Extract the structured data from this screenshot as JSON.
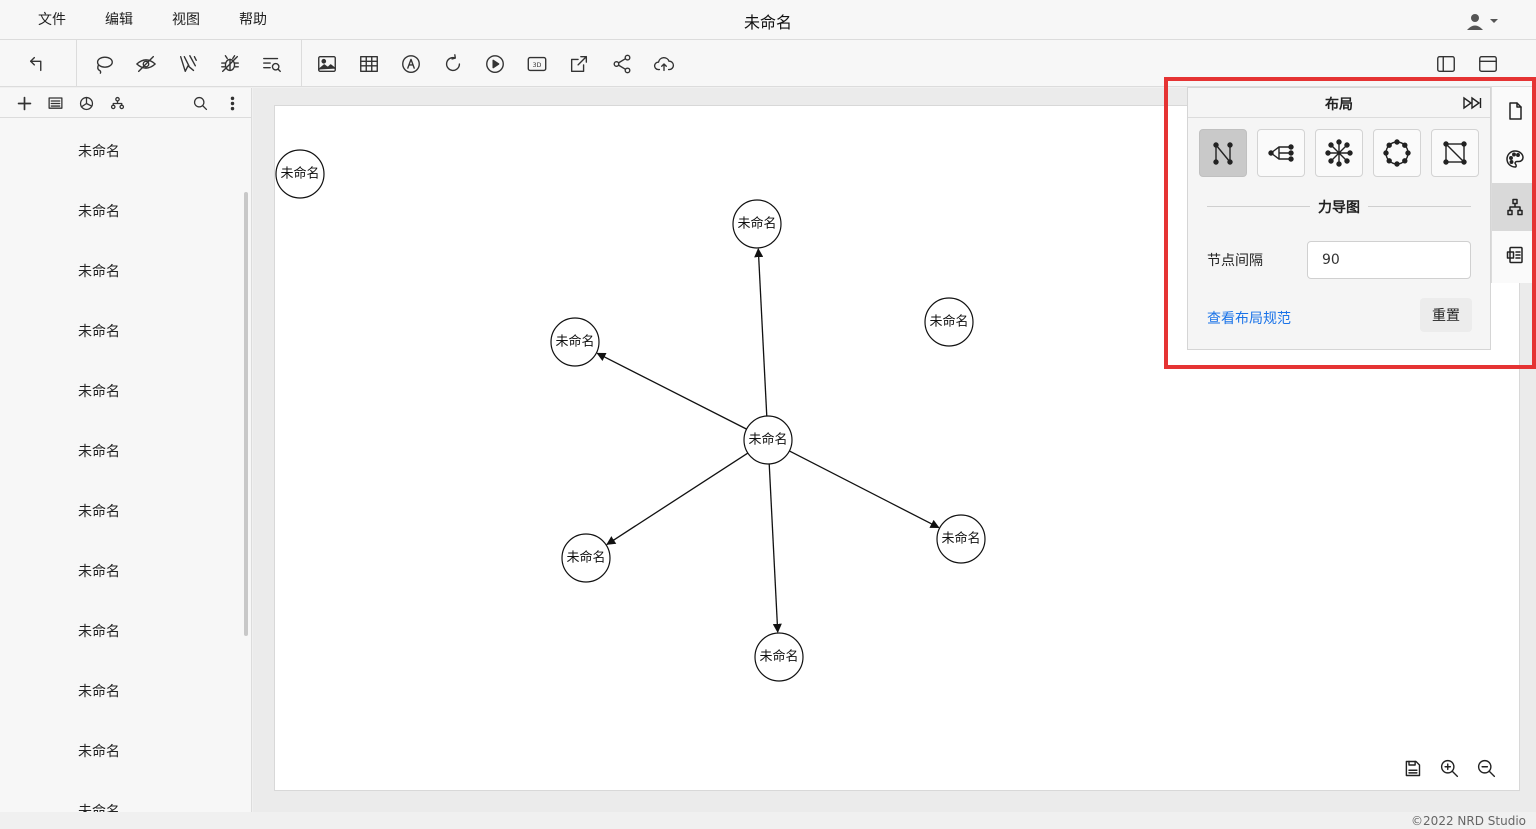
{
  "menu": {
    "items": [
      "文件",
      "编辑",
      "视图",
      "帮助"
    ],
    "title": "未命名"
  },
  "toolbar": {
    "buttons": [
      "undo-icon",
      "lasso-icon",
      "eye-off-icon",
      "brush-icon",
      "bug-icon",
      "filter-search-icon",
      "image-icon",
      "table-icon",
      "text-icon",
      "refresh-icon",
      "play-icon",
      "3d-icon",
      "export-icon",
      "share-icon",
      "cloud-upload-icon",
      "toggle-sidebar-icon",
      "toggle-panel-icon"
    ]
  },
  "sidebar": {
    "items": [
      "未命名",
      "未命名",
      "未命名",
      "未命名",
      "未命名",
      "未命名",
      "未命名",
      "未命名",
      "未命名",
      "未命名",
      "未命名",
      "未命名"
    ]
  },
  "graph": {
    "nodes": [
      {
        "label": "未命名"
      },
      {
        "label": "未命名"
      },
      {
        "label": "未命名"
      },
      {
        "label": "未命名"
      },
      {
        "label": "未命名"
      },
      {
        "label": "未命名"
      },
      {
        "label": "未命名"
      },
      {
        "label": "未命名"
      }
    ],
    "edges": [
      {
        "from": 4,
        "to": 1
      },
      {
        "from": 4,
        "to": 2
      },
      {
        "from": 4,
        "to": 5
      },
      {
        "from": 4,
        "to": 6
      },
      {
        "from": 4,
        "to": 7
      }
    ]
  },
  "layout_panel": {
    "title": "布局",
    "options": [
      "force-layout-icon",
      "tree-layout-icon",
      "radial-layout-icon",
      "circular-layout-icon",
      "grid-layout-icon"
    ],
    "selected": "force-layout-icon",
    "section_title": "力导图",
    "spacing_label": "节点间隔",
    "spacing_value": "90",
    "spec_link": "查看布局规范",
    "reset_label": "重置"
  },
  "right_rail": {
    "items": [
      "page-icon",
      "palette-icon",
      "layout-icon",
      "info-card-icon"
    ],
    "active": "layout-icon"
  },
  "footer": {
    "copyright": "©2022 NRD Studio"
  },
  "colors": {
    "highlight": "#e53333",
    "link": "#1a73e8"
  }
}
